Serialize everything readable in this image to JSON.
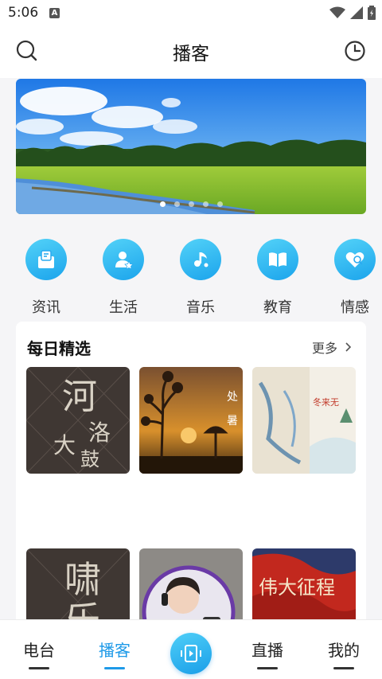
{
  "status": {
    "time": "5:06",
    "notif_badge": "A"
  },
  "header": {
    "title": "播客",
    "search_icon": "search-icon",
    "history_icon": "clock-icon"
  },
  "banner": {
    "dots": 5,
    "active_dot": 1
  },
  "categories": [
    {
      "label": "资讯",
      "icon": "news-icon"
    },
    {
      "label": "生活",
      "icon": "life-icon"
    },
    {
      "label": "音乐",
      "icon": "music-icon"
    },
    {
      "label": "教育",
      "icon": "book-icon"
    },
    {
      "label": "情感",
      "icon": "heart-icon"
    }
  ],
  "daily": {
    "title": "每日精选",
    "more": "更多",
    "items": [
      {
        "art_text": "河洛大鼓",
        "chars": [
          "河",
          "洛",
          "大",
          "鼓"
        ]
      },
      {
        "art_text": "处暑",
        "chars": [
          "处",
          "暑"
        ]
      },
      {
        "art_text": "冬来无",
        "chars": [
          "冬来无"
        ]
      },
      {
        "art_text": "啸乐",
        "chars": [
          "啸",
          "乐"
        ]
      },
      {
        "art_text": "",
        "chars": []
      },
      {
        "art_text": "伟大征程",
        "chars": [
          "伟大征程"
        ]
      }
    ]
  },
  "tabbar": {
    "tabs": [
      {
        "label": "电台",
        "active": false
      },
      {
        "label": "播客",
        "active": true
      },
      {
        "label": "直播",
        "active": false
      },
      {
        "label": "我的",
        "active": false
      }
    ],
    "center_icon": "broadcast-icon"
  },
  "colors": {
    "accent": "#1e9ae8",
    "icon_gradient_start": "#53d2f8",
    "icon_gradient_end": "#1ba4ec"
  }
}
